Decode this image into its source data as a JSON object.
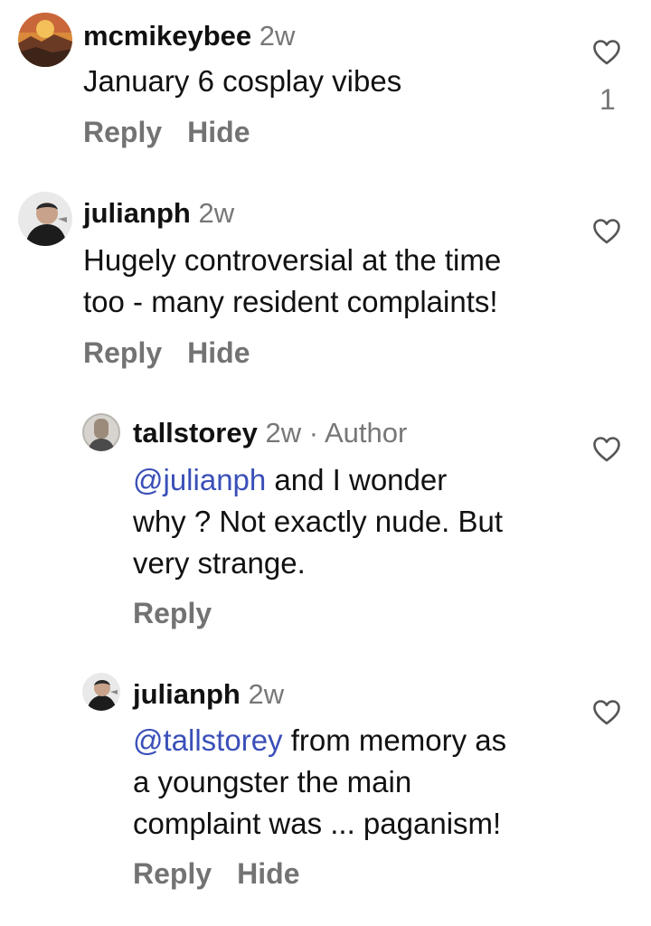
{
  "comments": [
    {
      "username": "mcmikeybee",
      "time": "2w",
      "author_tag": "",
      "mention": "",
      "text": "January 6 cosplay vibes",
      "reply_label": "Reply",
      "hide_label": "Hide",
      "like_count": "1"
    },
    {
      "username": "julianph",
      "time": "2w",
      "author_tag": "",
      "mention": "",
      "text_lines": [
        "Hugely controversial at the time",
        "too - many resident complaints!"
      ],
      "reply_label": "Reply",
      "hide_label": "Hide"
    },
    {
      "username": "tallstorey",
      "time": "2w",
      "author_tag": "· Author",
      "mention": "@julianph",
      "text_lines": [
        " and I wonder",
        "why ? Not exactly nude. But",
        "very strange."
      ],
      "reply_label": "Reply"
    },
    {
      "username": "julianph",
      "time": "2w",
      "author_tag": "",
      "mention": "@tallstorey",
      "text_lines": [
        " from memory as",
        "a youngster the main",
        "complaint was ... paganism!"
      ],
      "reply_label": "Reply",
      "hide_label": "Hide"
    }
  ],
  "icons": {
    "like": "heart-outline-icon"
  },
  "colors": {
    "mention": "#3a4fb8",
    "secondary_text": "#737373",
    "primary_text": "#111111"
  }
}
